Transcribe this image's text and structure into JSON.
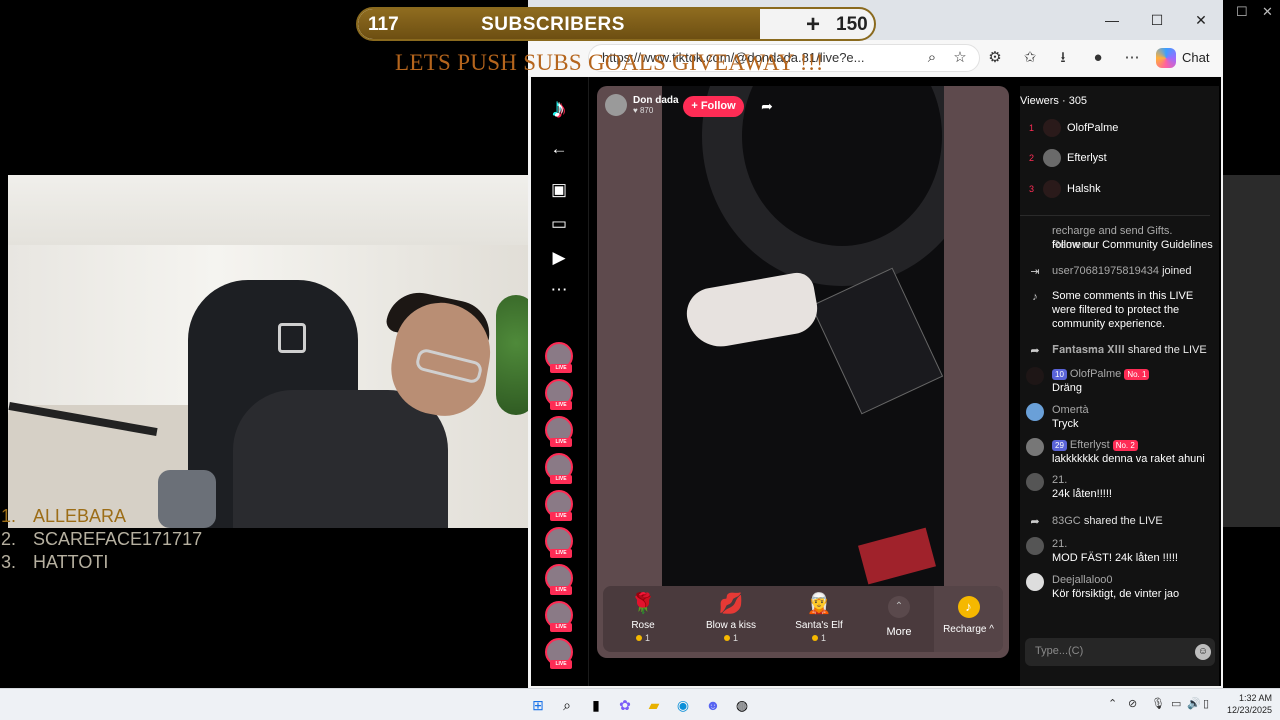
{
  "overlay": {
    "subscribers_current": "117",
    "subscribers_label": "SUBSCRIBERS",
    "subscribers_goal": "150",
    "subscriber_progress": 0.78,
    "push_text": "LETS PUSH SUBS GOALS GIVEAWAY !!!",
    "top_list": [
      {
        "rank": "1.",
        "name": "ALLEBARA"
      },
      {
        "rank": "2.",
        "name": "SCAREFACE171717"
      },
      {
        "rank": "3.",
        "name": "HATTOTI"
      }
    ]
  },
  "browser": {
    "tab_close": "✕",
    "url": "https://www.tiktok.com/@dondada.81/live?e...",
    "chat_label": "Chat",
    "controls": {
      "minimize": "—",
      "maximize": "☐",
      "close": "✕"
    }
  },
  "tiktok": {
    "host_name": "Don dada",
    "host_likes": "♥ 870",
    "follow_label": "+ Follow",
    "live_tag": "LIVE",
    "gifts": [
      {
        "name": "Rose",
        "cost": "1",
        "icon": "🌹"
      },
      {
        "name": "Blow a kiss",
        "cost": "1",
        "icon": "💋"
      },
      {
        "name": "Santa's Elf",
        "cost": "1",
        "icon": "🧝"
      }
    ],
    "more_label": "More",
    "recharge_label": "Recharge ^",
    "viewers_title": "Viewers · 305",
    "viewers": [
      {
        "rank": "1",
        "name": "OlofPalme"
      },
      {
        "rank": "2",
        "name": "Efterlyst"
      },
      {
        "rank": "3",
        "name": "Halshk"
      }
    ],
    "chat": {
      "partial_top_1": "recharge and send Gifts. Remem",
      "partial_top_2": "follow our Community Guidelines",
      "m1_user": "user70681975819434",
      "m1_action": "joined",
      "m2_text": "Some comments in this LIVE were filtered to protect the community experience.",
      "m3_user": "𝐅𝐚𝐧𝐭𝐚𝐬𝐦𝐚 𝐗𝐈𝐈𝐈",
      "m3_action": "shared the LIVE",
      "m4_badge": "10",
      "m4_user": "OlofPalme",
      "m4_rank": "No. 1",
      "m4_text": "Dräng",
      "m5_user": "Omertà",
      "m5_text": "Tryck",
      "m6_badge": "29",
      "m6_user": "Efterlyst",
      "m6_rank": "No. 2",
      "m6_text": "lakkkkkkk denna va raket ahuni",
      "m7_user": "21.",
      "m7_text": "24k låten!!!!!",
      "m8_user": "83GC",
      "m8_action": "shared the LIVE",
      "m9_user": "21.",
      "m9_text": "MOD FÄST! 24k låten !!!!!",
      "m10_user": "Deejallaloo0",
      "m10_text": "Kör försiktigt, de vinter jao"
    },
    "input_placeholder": "Type...(C)"
  },
  "taskbar": {
    "time": "1:32 AM",
    "date": "12/23/2025"
  },
  "colors": {
    "tiktok_red": "#fe2c55",
    "overlay_gold": "#8e6b1f",
    "list_gold": "#9c6d17"
  }
}
